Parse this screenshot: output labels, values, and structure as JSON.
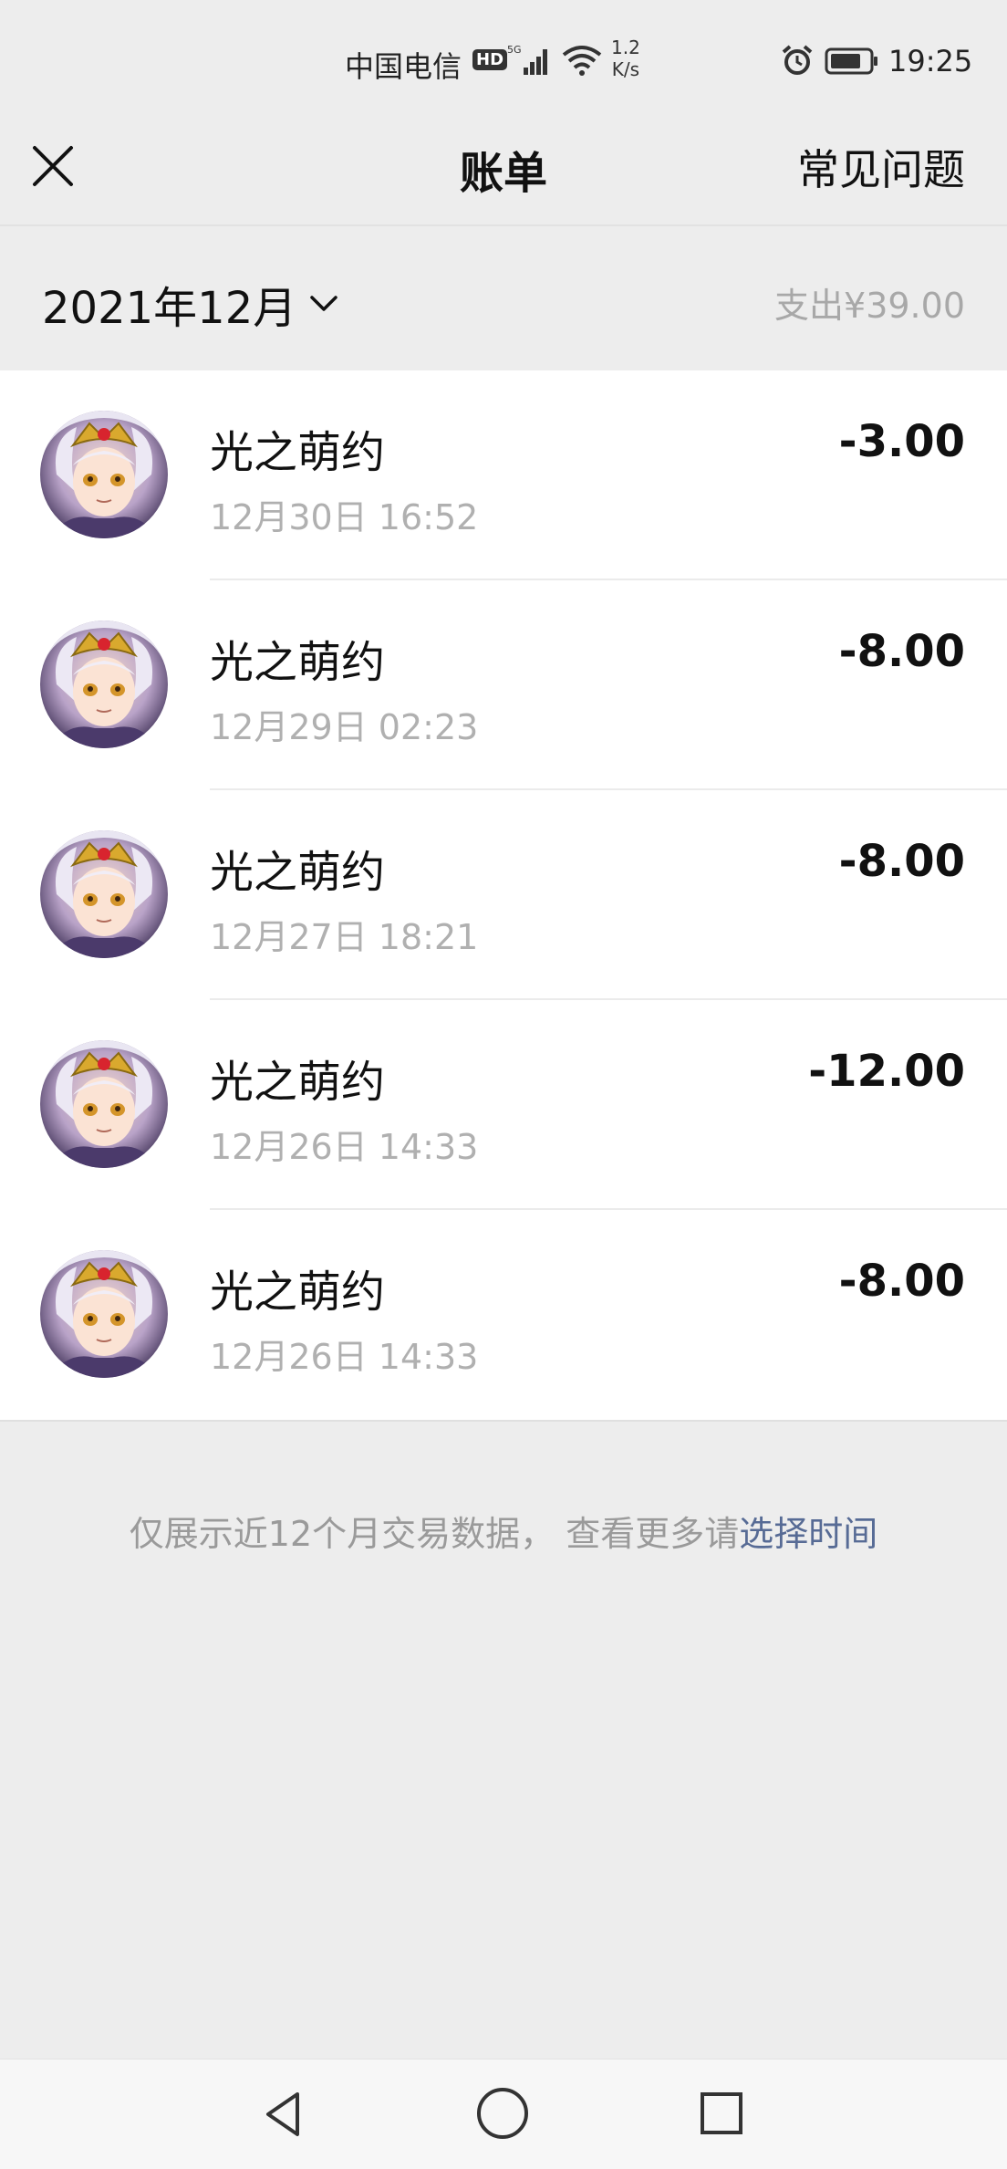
{
  "status_bar": {
    "carrier": "中国电信",
    "hd_badge": "HD",
    "network": "5G",
    "speed_value": "1.2",
    "speed_unit": "K/s",
    "time": "19:25"
  },
  "nav": {
    "title": "账单",
    "faq_label": "常见问题",
    "close_icon": "close-icon"
  },
  "month": {
    "label": "2021年12月",
    "total": "支出¥39.00"
  },
  "transactions": [
    {
      "merchant": "光之萌约",
      "datetime": "12月30日 16:52",
      "amount": "-3.00"
    },
    {
      "merchant": "光之萌约",
      "datetime": "12月29日 02:23",
      "amount": "-8.00"
    },
    {
      "merchant": "光之萌约",
      "datetime": "12月27日 18:21",
      "amount": "-8.00"
    },
    {
      "merchant": "光之萌约",
      "datetime": "12月26日 14:33",
      "amount": "-12.00"
    },
    {
      "merchant": "光之萌约",
      "datetime": "12月26日 14:33",
      "amount": "-8.00"
    }
  ],
  "footer_notice": {
    "text": "仅展示近12个月交易数据， 查看更多请",
    "link": "选择时间"
  },
  "colors": {
    "background": "#ededed",
    "link": "#576b95",
    "muted_text": "#b0b0b0"
  }
}
